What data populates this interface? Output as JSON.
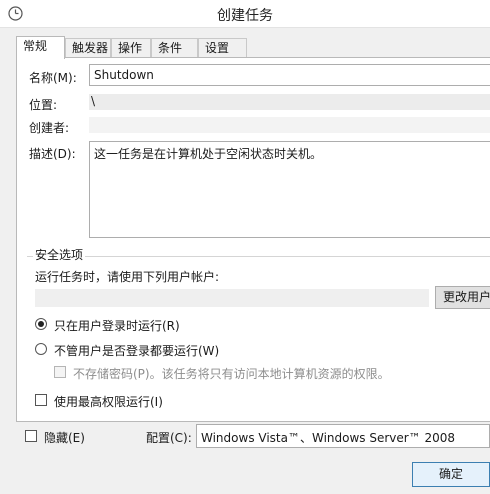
{
  "window": {
    "title": "创建任务"
  },
  "tabs": [
    {
      "label": "常规",
      "active": true
    },
    {
      "label": "触发器",
      "active": false
    },
    {
      "label": "操作",
      "active": false
    },
    {
      "label": "条件",
      "active": false
    },
    {
      "label": "设置",
      "active": false
    }
  ],
  "general": {
    "name_label": "名称(M):",
    "name_value": "Shutdown",
    "location_label": "位置:",
    "location_value": "\\",
    "author_label": "创建者:",
    "description_label": "描述(D):",
    "description_value": "这一任务是在计算机处于空闲状态时关机。"
  },
  "security": {
    "group_title": "安全选项",
    "run_as_label": "运行任务时，请使用下列用户帐户:",
    "change_user_button": "更改用户",
    "radio_logged_on": "只在用户登录时运行(R)",
    "radio_any": "不管用户是否登录都要运行(W)",
    "no_store_password": "不存储密码(P)。该任务将只有访问本地计算机资源的权限。",
    "highest_privileges": "使用最高权限运行(I)",
    "selected_radio": "logged_on"
  },
  "footer": {
    "hidden_label": "隐藏(E)",
    "configure_label": "配置(C):",
    "configure_value": "Windows Vista™、Windows Server™ 2008",
    "ok_button": "确定"
  }
}
